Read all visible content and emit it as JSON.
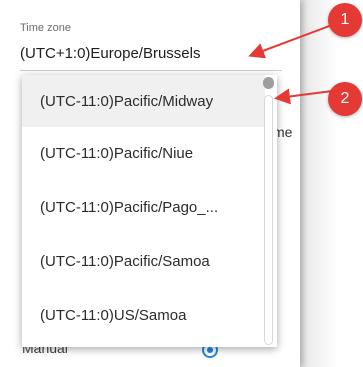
{
  "field": {
    "label": "Time zone",
    "value": "(UTC+1:0)Europe/Brussels"
  },
  "background": {
    "partial_text_right": "me",
    "partial_text_bottom": "Manual"
  },
  "dropdown": {
    "options": [
      {
        "label": "(UTC-11:0)Pacific/Midway",
        "selected": true
      },
      {
        "label": "(UTC-11:0)Pacific/Niue",
        "selected": false
      },
      {
        "label": "(UTC-11:0)Pacific/Pago_...",
        "selected": false
      },
      {
        "label": "(UTC-11:0)Pacific/Samoa",
        "selected": false
      },
      {
        "label": "(UTC-11:0)US/Samoa",
        "selected": false
      }
    ]
  },
  "annotations": {
    "badge1": "1",
    "badge2": "2",
    "color": "#e53935"
  }
}
